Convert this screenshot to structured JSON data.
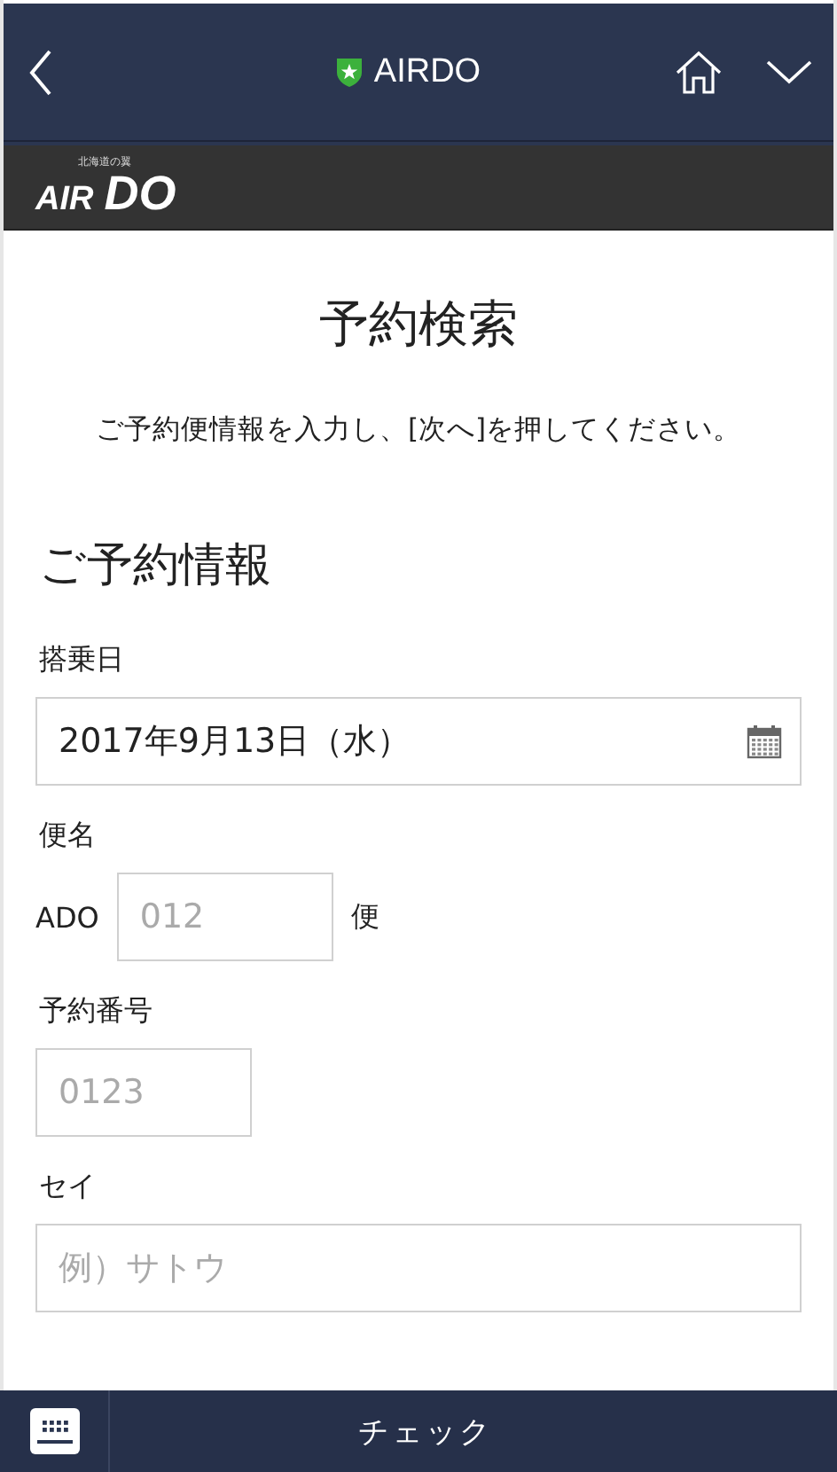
{
  "app_bar": {
    "title": "AIRDO"
  },
  "logo": {
    "tagline": "北海道の翼",
    "wordmark_left": "AIR",
    "wordmark_right": "DO"
  },
  "page": {
    "title": "予約検索",
    "instruction": "ご予約便情報を入力し、[次へ]を押してください。"
  },
  "section": {
    "heading": "ご予約情報"
  },
  "fields": [
    {
      "kind": "date",
      "label": "搭乗日",
      "value": "2017年9月13日（水）"
    },
    {
      "kind": "flight",
      "label": "便名",
      "prefix": "ADO",
      "placeholder": "012",
      "suffix": "便"
    },
    {
      "kind": "short",
      "label": "予約番号",
      "placeholder": "0123"
    },
    {
      "kind": "wide",
      "label": "セイ",
      "placeholder": "例）サトウ"
    }
  ],
  "bottom_bar": {
    "label": "チェック"
  }
}
